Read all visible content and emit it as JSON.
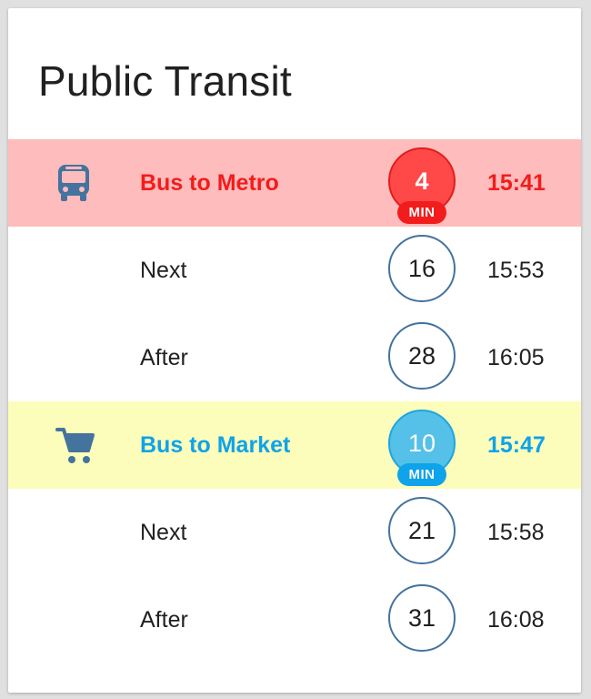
{
  "card": {
    "title": "Public Transit"
  },
  "colors": {
    "urgent_bg": "#ffbcbc",
    "urgent_text": "#f31c1c",
    "soon_bg": "#fdfdbb",
    "soon_text": "#0ea3ea",
    "icon": "#44739e",
    "badge_border": "#44739e"
  },
  "routes": [
    {
      "icon": "bus-icon",
      "rows": [
        {
          "label": "Bus to Metro",
          "minutes": "4",
          "unit": "MIN",
          "time": "15:41"
        },
        {
          "label": "Next",
          "minutes": "16",
          "time": "15:53"
        },
        {
          "label": "After",
          "minutes": "28",
          "time": "16:05"
        }
      ]
    },
    {
      "icon": "cart-icon",
      "rows": [
        {
          "label": "Bus to Market",
          "minutes": "10",
          "unit": "MIN",
          "time": "15:47"
        },
        {
          "label": "Next",
          "minutes": "21",
          "time": "15:58"
        },
        {
          "label": "After",
          "minutes": "31",
          "time": "16:08"
        }
      ]
    }
  ]
}
